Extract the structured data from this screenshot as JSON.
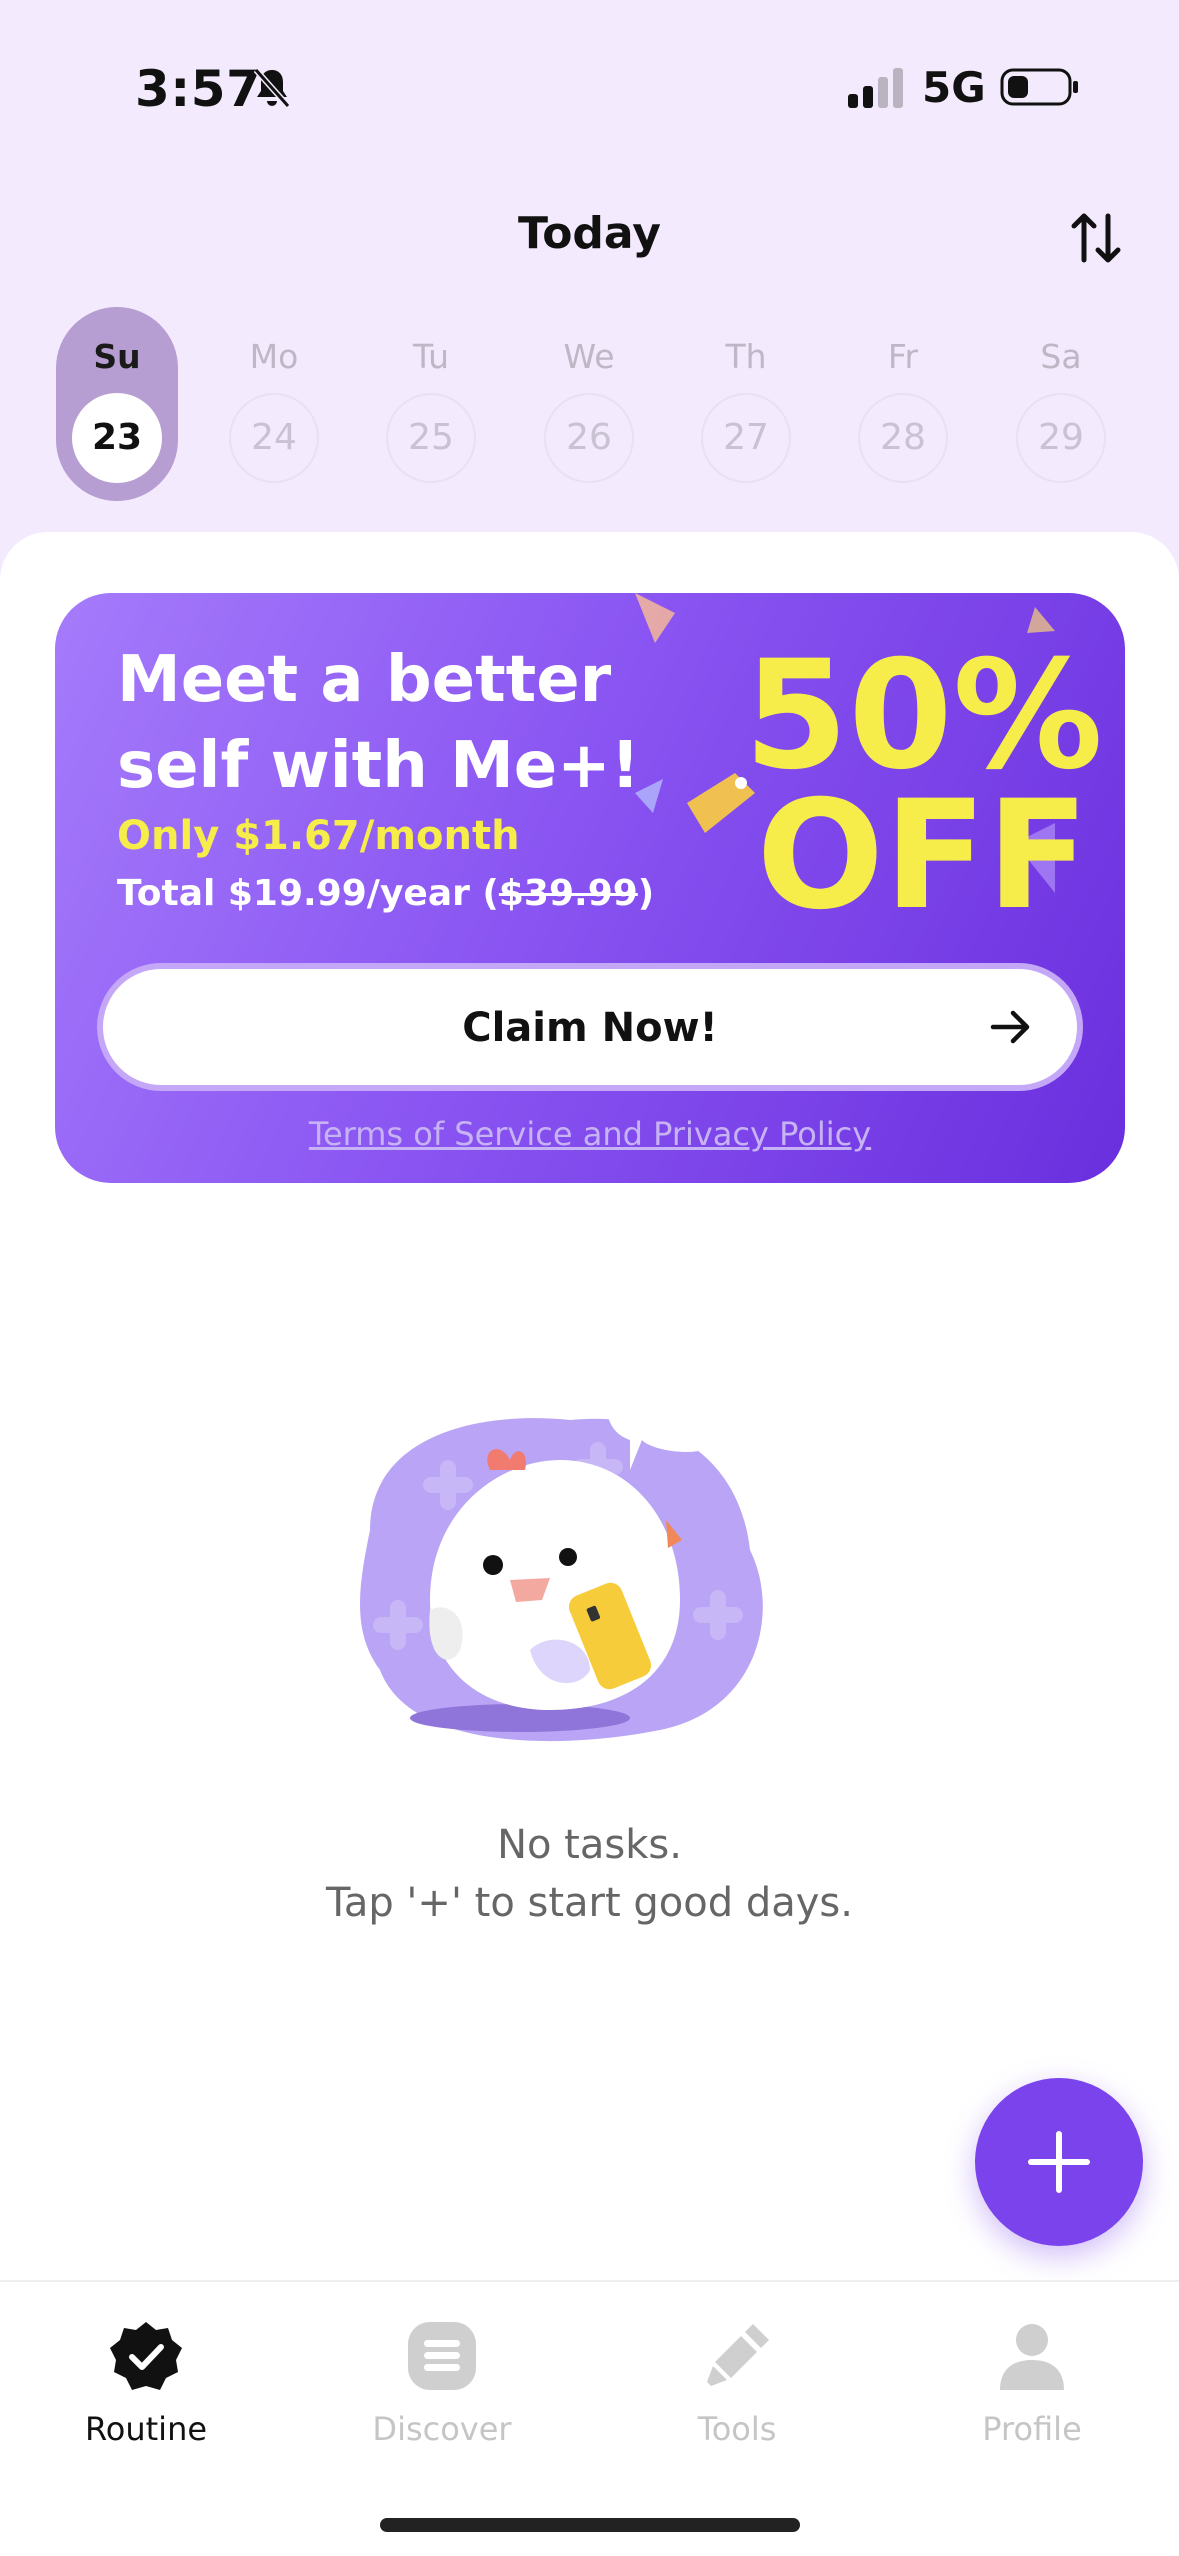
{
  "status_bar": {
    "time": "3:57",
    "network": "5G"
  },
  "header": {
    "title": "Today"
  },
  "week": [
    {
      "day": "Su",
      "date": "23",
      "selected": true
    },
    {
      "day": "Mo",
      "date": "24",
      "selected": false
    },
    {
      "day": "Tu",
      "date": "25",
      "selected": false
    },
    {
      "day": "We",
      "date": "26",
      "selected": false
    },
    {
      "day": "Th",
      "date": "27",
      "selected": false
    },
    {
      "day": "Fr",
      "date": "28",
      "selected": false
    },
    {
      "day": "Sa",
      "date": "29",
      "selected": false
    }
  ],
  "promo": {
    "title": "Meet a better self with Me+!",
    "price_line": "Only $1.67/month",
    "total_prefix": "Total $19.99/year (",
    "total_old": "$39.99",
    "total_suffix": ")",
    "discount": "50%",
    "discount_word": "OFF",
    "cta": "Claim Now!",
    "terms": "Terms of Service and Privacy Policy"
  },
  "empty_state": {
    "line1": "No tasks.",
    "line2": "Tap '+' to start good days."
  },
  "tabs": [
    {
      "label": "Routine",
      "icon": "check-badge-icon",
      "active": true
    },
    {
      "label": "Discover",
      "icon": "menu-list-icon",
      "active": false
    },
    {
      "label": "Tools",
      "icon": "tools-icon",
      "active": false
    },
    {
      "label": "Profile",
      "icon": "person-icon",
      "active": false
    }
  ],
  "colors": {
    "accent": "#7b43ec",
    "selected_day": "#b79ed2",
    "promo_yellow": "#f6ec4a",
    "top_bg": "#f3eafd"
  }
}
